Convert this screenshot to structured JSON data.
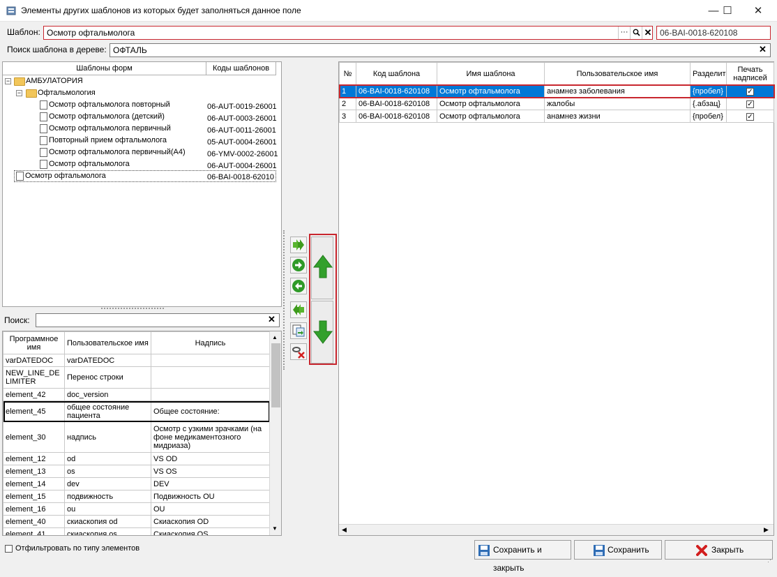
{
  "window": {
    "title": "Элементы других шаблонов из которых будет заполняться данное поле",
    "minimize": "—",
    "maximize": "☐",
    "close": "✕"
  },
  "template": {
    "label": "Шаблон:",
    "value": "Осмотр офтальмолога",
    "code": "06-BAI-0018-620108",
    "dots": "···"
  },
  "tree_search": {
    "label": "Поиск шаблона в дереве:",
    "value": "ОФТАЛЬ"
  },
  "tree": {
    "col_name": "Шаблоны форм",
    "col_code": "Коды шаблонов",
    "root": "АМБУЛАТОРИЯ",
    "folder": "Офтальмология",
    "items": [
      {
        "name": "Осмотр офтальмолога повторный",
        "code": "06-AUT-0019-26001"
      },
      {
        "name": "Осмотр офтальмолога (детский)",
        "code": "06-AUT-0003-26001"
      },
      {
        "name": "Осмотр офтальмолога первичный",
        "code": "06-AUT-0011-26001"
      },
      {
        "name": "Повторный прием офтальмолога",
        "code": "05-AUT-0004-26001"
      },
      {
        "name": "Осмотр офтальмолога первичный(А4)",
        "code": "06-YMV-0002-26001"
      },
      {
        "name": "Осмотр офтальмолога",
        "code": "06-AUT-0004-26001"
      }
    ],
    "selected": {
      "name": "Осмотр офтальмолога",
      "code": "06-BAI-0018-62010"
    }
  },
  "search": {
    "label": "Поиск:",
    "value": ""
  },
  "elements": {
    "headers": [
      "Программное имя",
      "Пользовательское имя",
      "Надпись"
    ],
    "rows": [
      [
        "varDATEDOC",
        "varDATEDOC",
        ""
      ],
      [
        "NEW_LINE_DELIMITER",
        "Перенос строки",
        ""
      ],
      [
        "element_42",
        "doc_version",
        ""
      ],
      [
        "element_45",
        "общее  состояние пациента",
        "Общее состояние:"
      ],
      [
        "element_30",
        "надпись",
        "Осмотр с узкими зрачками (на фоне медикаментозного мидриаза)"
      ],
      [
        "element_12",
        "od",
        "VS OD"
      ],
      [
        "element_13",
        "os",
        "VS OS"
      ],
      [
        "element_14",
        "dev",
        "DEV"
      ],
      [
        "element_15",
        "подвижность",
        "Подвижность OU"
      ],
      [
        "element_16",
        "ou",
        "OU"
      ],
      [
        "element_40",
        "скиаскопия od",
        "Скиаскопия OD"
      ],
      [
        "element_41",
        "скиаскопия os",
        "Скиаскопия OS"
      ]
    ]
  },
  "filter": {
    "label": "Отфильтровать по типу элементов"
  },
  "selected_table": {
    "headers": [
      "№",
      "Код шаблона",
      "Имя шаблона",
      "Пользовательское имя",
      "Разделитель",
      "Печать надписей"
    ],
    "rows": [
      [
        "1",
        "06-BAI-0018-620108",
        "Осмотр офтальмолога",
        "анамнез заболевания",
        "{пробел}"
      ],
      [
        "2",
        "06-BAI-0018-620108",
        "Осмотр офтальмолога",
        "жалобы",
        "{.абзац}"
      ],
      [
        "3",
        "06-BAI-0018-620108",
        "Осмотр офтальмолога",
        "анамнез жизни",
        "{пробел}"
      ]
    ]
  },
  "buttons": {
    "save_close": "Сохранить и закрыть",
    "save": "Сохранить",
    "close": "Закрыть"
  },
  "colors": {
    "selection": "#0078d7",
    "accent_red": "#c8262e",
    "arrow_green": "#3fae29"
  }
}
